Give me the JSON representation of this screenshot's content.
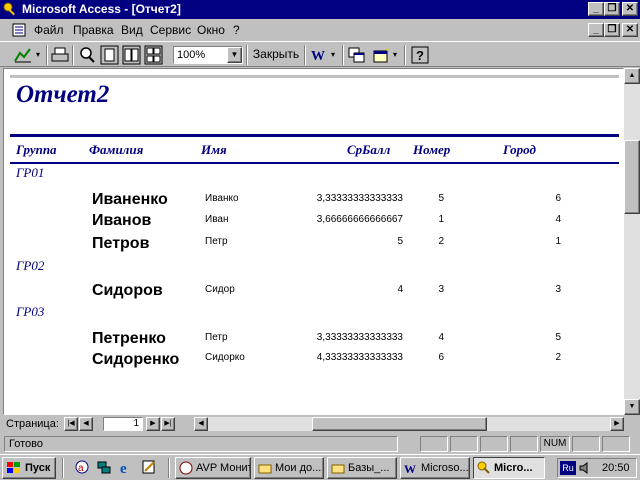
{
  "window": {
    "title": "Microsoft Access - [Отчет2]"
  },
  "menu": [
    "Файл",
    "Правка",
    "Вид",
    "Сервис",
    "Окно",
    "?"
  ],
  "toolbar": {
    "zoom": "100%",
    "close_label": "Закрыть"
  },
  "report": {
    "title": "Отчет2",
    "headers": [
      "Группа",
      "Фамилия",
      "Имя",
      "СрБалл",
      "Номер",
      "Город"
    ],
    "groups": [
      {
        "name": "ГР01",
        "rows": [
          {
            "surname": "Иваненко",
            "name": "Иванко",
            "avg": "3,33333333333333",
            "num": "5",
            "city": "6"
          },
          {
            "surname": "Иванов",
            "name": "Иван",
            "avg": "3,66666666666667",
            "num": "1",
            "city": "4"
          },
          {
            "surname": "Петров",
            "name": "Петр",
            "avg": "5",
            "num": "2",
            "city": "1"
          }
        ]
      },
      {
        "name": "ГР02",
        "rows": [
          {
            "surname": "Сидоров",
            "name": "Сидор",
            "avg": "4",
            "num": "3",
            "city": "3"
          }
        ]
      },
      {
        "name": "ГР03",
        "rows": [
          {
            "surname": "Петренко",
            "name": "Петр",
            "avg": "3,33333333333333",
            "num": "4",
            "city": "5"
          },
          {
            "surname": "Сидоренко",
            "name": "Сидорко",
            "avg": "4,33333333333333",
            "num": "6",
            "city": "2"
          }
        ]
      }
    ]
  },
  "navigation": {
    "page_label": "Страница:",
    "page": "1"
  },
  "status": {
    "text": "Готово",
    "num": "NUM"
  },
  "taskbar": {
    "start": "Пуск",
    "tasks": [
      "AVP Монит...",
      "Мои до...",
      "Базы_...",
      "Microso...",
      "Micro..."
    ],
    "time": "20:50",
    "lang": "Ru"
  }
}
